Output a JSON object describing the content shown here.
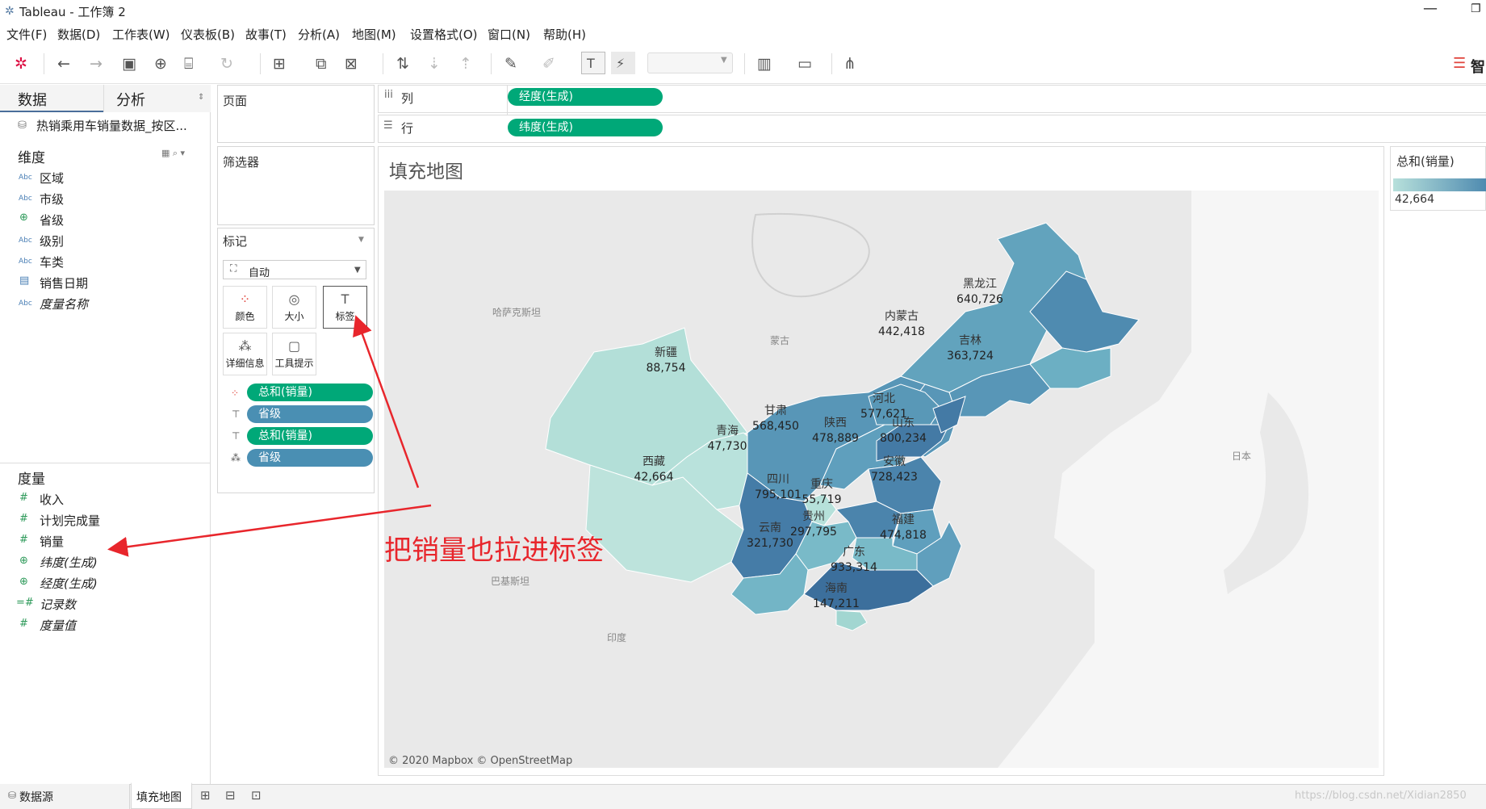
{
  "window": {
    "title": "Tableau - 工作簿 2"
  },
  "menu": [
    "文件(F)",
    "数据(D)",
    "工作表(W)",
    "仪表板(B)",
    "故事(T)",
    "分析(A)",
    "地图(M)",
    "设置格式(O)",
    "窗口(N)",
    "帮助(H)"
  ],
  "toolbar": {
    "smart_label": "智"
  },
  "data_pane": {
    "tab_data": "数据",
    "tab_analysis": "分析",
    "datasource": "热销乘用车销量数据_按区...",
    "dimensions_header": "维度",
    "dimensions": [
      {
        "label": "区域",
        "icon": "abc-icon"
      },
      {
        "label": "市级",
        "icon": "abc-icon"
      },
      {
        "label": "省级",
        "icon": "globe-icon"
      },
      {
        "label": "级别",
        "icon": "abc-icon"
      },
      {
        "label": "车类",
        "icon": "abc-icon"
      },
      {
        "label": "销售日期",
        "icon": "calendar-icon"
      },
      {
        "label": "度量名称",
        "icon": "abc-icon"
      }
    ],
    "measures_header": "度量",
    "measures": [
      {
        "label": "收入",
        "icon": "hash-icon"
      },
      {
        "label": "计划完成量",
        "icon": "hash-icon"
      },
      {
        "label": "销量",
        "icon": "hash-icon"
      },
      {
        "label": "纬度(生成)",
        "icon": "globe-icon"
      },
      {
        "label": "经度(生成)",
        "icon": "globe-icon"
      },
      {
        "label": "记录数",
        "icon": "hash-icon"
      },
      {
        "label": "度量值",
        "icon": "hash-icon"
      }
    ]
  },
  "pages_card": {
    "title": "页面"
  },
  "filters_card": {
    "title": "筛选器"
  },
  "marks_card": {
    "title": "标记",
    "mark_type": "自动",
    "buttons": [
      "颜色",
      "大小",
      "标签",
      "详细信息",
      "工具提示"
    ],
    "pills": [
      {
        "label": "总和(销量)",
        "kind": "green",
        "icon": "color-icon"
      },
      {
        "label": "省级",
        "kind": "blue",
        "icon": "label-icon"
      },
      {
        "label": "总和(销量)",
        "kind": "green",
        "icon": "label-icon"
      },
      {
        "label": "省级",
        "kind": "blue",
        "icon": "detail-icon"
      }
    ]
  },
  "shelves": {
    "columns_label": "列",
    "columns_pill": "经度(生成)",
    "rows_label": "行",
    "rows_pill": "纬度(生成)"
  },
  "view": {
    "title": "填充地图",
    "attribution": "© 2020 Mapbox © OpenStreetMap",
    "basemap_labels": [
      "哈萨克斯坦",
      "蒙古",
      "日本",
      "巴基斯坦",
      "印度",
      "青海"
    ],
    "provinces": [
      {
        "name": "黑龙江",
        "value": "640,726",
        "color": "#4f8bb0"
      },
      {
        "name": "内蒙古",
        "value": "442,418",
        "color": "#62a3bd"
      },
      {
        "name": "吉林",
        "value": "363,724",
        "color": "#6cafc3"
      },
      {
        "name": "新疆",
        "value": "88,754",
        "color": "#b3dfd8"
      },
      {
        "name": "河北",
        "value": "577,621",
        "color": "#5896b7"
      },
      {
        "name": "甘肃",
        "value": "568,450",
        "color": "#5998b7"
      },
      {
        "name": "山东",
        "value": "800,234",
        "color": "#447aa5"
      },
      {
        "name": "陕西",
        "value": "478,889",
        "color": "#5f9fbd"
      },
      {
        "name": "青海",
        "value": "47,730",
        "color": "#b9e2dc"
      },
      {
        "name": "安徽",
        "value": "728,423",
        "color": "#4b84ac"
      },
      {
        "name": "西藏",
        "value": "42,664",
        "color": "#bde3dc"
      },
      {
        "name": "四川",
        "value": "795,101",
        "color": "#457ca7"
      },
      {
        "name": "重庆",
        "value": "55,719",
        "color": "#b6e1da"
      },
      {
        "name": "贵州",
        "value": "297,795",
        "color": "#79bac8"
      },
      {
        "name": "福建",
        "value": "474,818",
        "color": "#609fbd"
      },
      {
        "name": "云南",
        "value": "321,730",
        "color": "#73b5c6"
      },
      {
        "name": "广东",
        "value": "933,314",
        "color": "#3c6f9c"
      },
      {
        "name": "海南",
        "value": "147,211",
        "color": "#a2d6d1"
      }
    ]
  },
  "legend": {
    "title": "总和(销量)",
    "min_label": "42,664"
  },
  "annotation": {
    "text": "把销量也拉进标签"
  },
  "bottom_bar": {
    "datasource_tab": "数据源",
    "sheet_tab": "填充地图",
    "watermark": "https://blog.csdn.net/Xidian2850"
  }
}
